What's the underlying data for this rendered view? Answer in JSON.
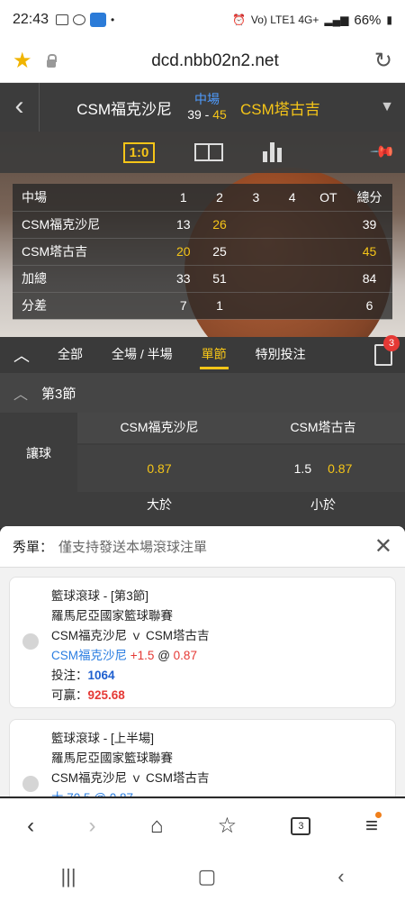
{
  "status_bar": {
    "time": "22:43",
    "battery": "66%",
    "network": "Vo) LTE1 4G+"
  },
  "address_bar": {
    "url": "dcd.nbb02n2.net"
  },
  "match": {
    "home_team": "CSM福克沙尼",
    "away_team": "CSM塔古吉",
    "period": "中場",
    "home_score": "39",
    "away_score": "45"
  },
  "hero": {
    "score_tab_label": "1:0"
  },
  "score_table": {
    "headers": [
      "中場",
      "1",
      "2",
      "3",
      "4",
      "OT",
      "總分"
    ],
    "rows": [
      [
        "CSM福克沙尼",
        "13",
        "26",
        "",
        "",
        "",
        "39"
      ],
      [
        "CSM塔古吉",
        "20",
        "25",
        "",
        "",
        "",
        "45"
      ],
      [
        "加總",
        "33",
        "51",
        "",
        "",
        "",
        "84"
      ],
      [
        "分差",
        "7",
        "1",
        "",
        "",
        "",
        "6"
      ]
    ]
  },
  "tabs": {
    "items": [
      "全部",
      "全場 / 半場",
      "單節",
      "特別投注"
    ],
    "active": "單節",
    "betslip_count": "3"
  },
  "section": {
    "title": "第3節"
  },
  "market": {
    "label": "讓球",
    "home_col": "CSM福克沙尼",
    "away_col": "CSM塔古吉",
    "home_odds": "0.87",
    "away_handicap": "1.5",
    "away_odds": "0.87",
    "over_label": "大於",
    "under_label": "小於"
  },
  "sheet": {
    "title": "秀單：",
    "subtitle": "僅支持發送本場滾球注單",
    "cards": [
      {
        "line1": "籃球滾球 - [第3節]",
        "line2": "羅馬尼亞國家籃球聯賽",
        "line3": "CSM福克沙尼 ｖ CSM塔古吉",
        "pick_team": "CSM福克沙尼",
        "pick_line": "+1.5",
        "pick_at": "@",
        "pick_odds": "0.87",
        "stake_label": "投注：",
        "stake": "1064",
        "win_label": "可贏：",
        "win": "925.68"
      },
      {
        "line1": "籃球滾球 - [上半場]",
        "line2": "羅馬尼亞國家籃球聯賽",
        "line3": "CSM福克沙尼 ｖ CSM塔古吉",
        "pick_partial": "大 70.5 @ 0.87"
      }
    ]
  },
  "browser_nav": {
    "tab_count": "3"
  },
  "icons": {
    "favorite": "star-icon",
    "lock": "lock-icon",
    "reload": "reload-icon",
    "back": "chevron-left-icon",
    "pin": "pin-icon",
    "close": "close-icon"
  }
}
